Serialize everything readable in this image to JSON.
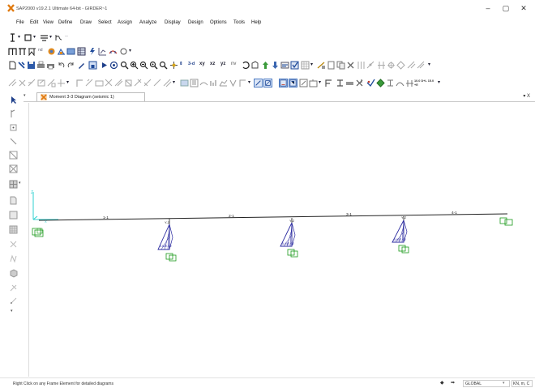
{
  "window": {
    "title": "SAP2000 v19.2.1 Ultimate 64-bit - GIRDER~1",
    "minimize_glyph": "–",
    "maximize_glyph": "▢",
    "close_glyph": "✕",
    "app_icon": "sap2000-logo-icon"
  },
  "menu": [
    "File",
    "Edit",
    "View",
    "Define",
    "Draw",
    "Select",
    "Assign",
    "Analyze",
    "Display",
    "Design",
    "Options",
    "Tools",
    "Help"
  ],
  "toolbar1": {
    "icons": [
      "section-tool-icon",
      "frame-dropdown-icon",
      "analysis-wand-icon",
      "spring-icon"
    ]
  },
  "toolbar2": {
    "nd_label": "nd",
    "icons": [
      "frame-rect-icon",
      "beam-icon",
      "moment-icon",
      "load-icon",
      "bridge-icon",
      "table-icon",
      "lightning-icon",
      "chart-icon",
      "bridge-wizard-icon"
    ]
  },
  "toolbar3": {
    "view_3d": "3-d",
    "view_xy": "xy",
    "view_xz": "xz",
    "view_yz": "yz",
    "view_nv": "nv",
    "icons": [
      "new-icon",
      "save-icon",
      "print-icon",
      "undo-icon",
      "redo-icon",
      "pencil-icon",
      "lock-icon",
      "run-icon",
      "stop-icon",
      "zoom-window-icon",
      "zoom-in-icon",
      "zoom-out-icon",
      "zoom-fit-icon",
      "zoom-previous-icon",
      "pan-icon",
      "refresh-icon"
    ]
  },
  "toolbar4": {
    "units_label": "10.0 D+L 15.0 +E"
  },
  "tab": {
    "label": "Moment 3-3 Diagram (seismic 1)",
    "close_all": "▾ X",
    "dropdown": "▾"
  },
  "model": {
    "frame_labels": [
      "1-1",
      "2-1",
      "3-1",
      "4-1"
    ],
    "column_labels": [
      "Y-Z",
      "Y-Z",
      "Y-Z"
    ],
    "moment_values": [
      "4.62E-02",
      "6.44E-02",
      "4.60E-02"
    ],
    "axis_labels": {
      "z": "Z",
      "x": "X"
    }
  },
  "status": {
    "message": "Right Click on any Frame Element for detailed diagrams",
    "coord_system": "GLOBAL",
    "units": "KN, m, C"
  }
}
